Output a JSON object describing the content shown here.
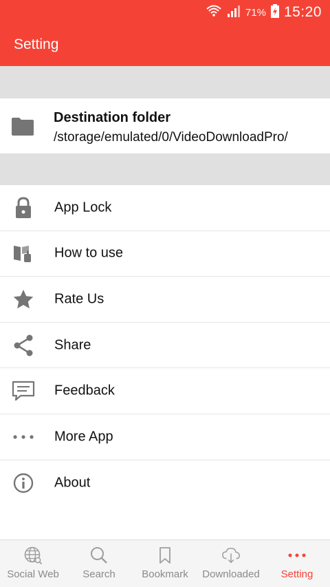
{
  "status_bar": {
    "battery_percent": "71%",
    "time": "15:20",
    "icons": [
      "wifi-icon",
      "signal-icon",
      "battery-charging-icon"
    ]
  },
  "app_bar": {
    "title": "Setting"
  },
  "destination": {
    "title": "Destination folder",
    "path": "/storage/emulated/0/VideoDownloadPro/",
    "icon": "folder-icon"
  },
  "menu": {
    "items": [
      {
        "label": "App Lock",
        "icon": "lock-icon"
      },
      {
        "label": "How to use",
        "icon": "book-hand-icon"
      },
      {
        "label": "Rate Us",
        "icon": "star-icon"
      },
      {
        "label": "Share",
        "icon": "share-icon"
      },
      {
        "label": "Feedback",
        "icon": "chat-icon"
      },
      {
        "label": "More App",
        "icon": "more-dots-icon"
      },
      {
        "label": "About",
        "icon": "info-icon"
      }
    ]
  },
  "bottom_nav": {
    "items": [
      {
        "label": "Social Web",
        "icon": "globe-icon",
        "active": false
      },
      {
        "label": "Search",
        "icon": "search-icon",
        "active": false
      },
      {
        "label": "Bookmark",
        "icon": "bookmark-icon",
        "active": false
      },
      {
        "label": "Downloaded",
        "icon": "cloud-download-icon",
        "active": false
      },
      {
        "label": "Setting",
        "icon": "more-dots-icon",
        "active": true
      }
    ]
  },
  "colors": {
    "accent": "#f44336",
    "icon_gray": "#757575",
    "nav_gray": "#9e9e9e"
  }
}
